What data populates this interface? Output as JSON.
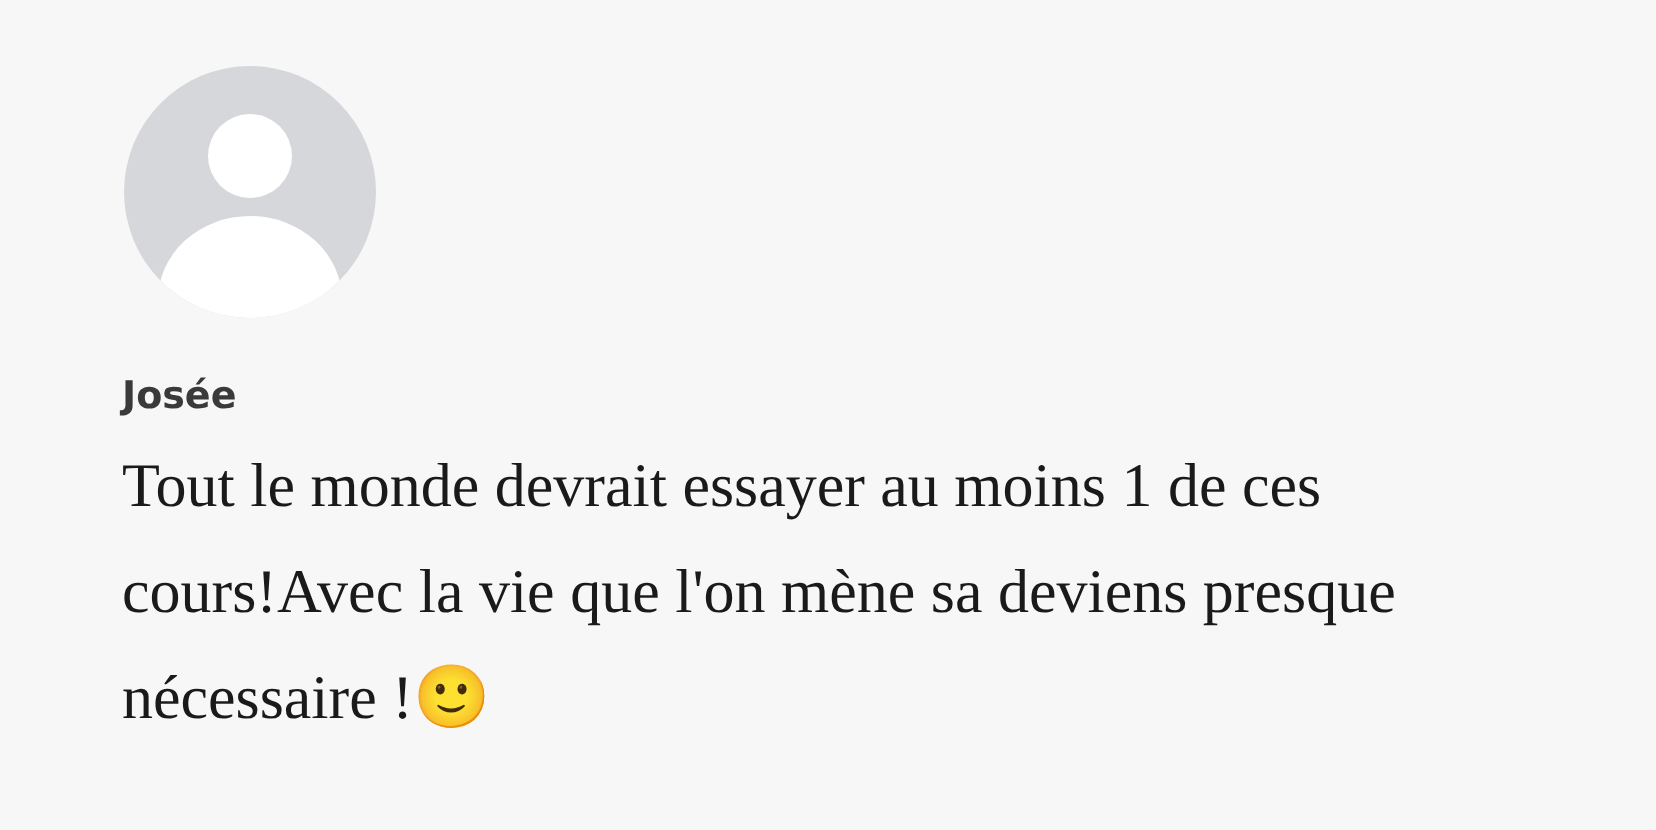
{
  "comment": {
    "author": "Josée",
    "text": "Tout le monde devrait essayer au moins 1 de ces cours!Avec la vie que l'on mène sa deviens presque nécessaire !🙂"
  }
}
